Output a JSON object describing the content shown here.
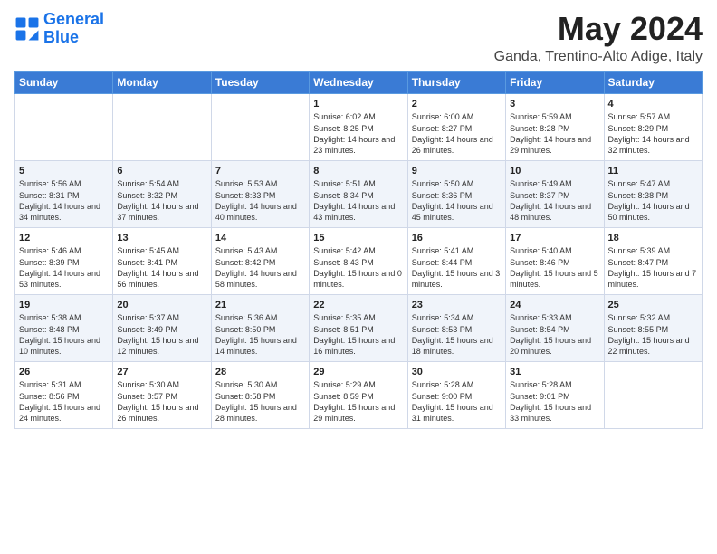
{
  "logo": {
    "line1": "General",
    "line2": "Blue"
  },
  "title": "May 2024",
  "subtitle": "Ganda, Trentino-Alto Adige, Italy",
  "days_of_week": [
    "Sunday",
    "Monday",
    "Tuesday",
    "Wednesday",
    "Thursday",
    "Friday",
    "Saturday"
  ],
  "weeks": [
    [
      {
        "day": "",
        "sunrise": "",
        "sunset": "",
        "daylight": ""
      },
      {
        "day": "",
        "sunrise": "",
        "sunset": "",
        "daylight": ""
      },
      {
        "day": "",
        "sunrise": "",
        "sunset": "",
        "daylight": ""
      },
      {
        "day": "1",
        "sunrise": "Sunrise: 6:02 AM",
        "sunset": "Sunset: 8:25 PM",
        "daylight": "Daylight: 14 hours and 23 minutes."
      },
      {
        "day": "2",
        "sunrise": "Sunrise: 6:00 AM",
        "sunset": "Sunset: 8:27 PM",
        "daylight": "Daylight: 14 hours and 26 minutes."
      },
      {
        "day": "3",
        "sunrise": "Sunrise: 5:59 AM",
        "sunset": "Sunset: 8:28 PM",
        "daylight": "Daylight: 14 hours and 29 minutes."
      },
      {
        "day": "4",
        "sunrise": "Sunrise: 5:57 AM",
        "sunset": "Sunset: 8:29 PM",
        "daylight": "Daylight: 14 hours and 32 minutes."
      }
    ],
    [
      {
        "day": "5",
        "sunrise": "Sunrise: 5:56 AM",
        "sunset": "Sunset: 8:31 PM",
        "daylight": "Daylight: 14 hours and 34 minutes."
      },
      {
        "day": "6",
        "sunrise": "Sunrise: 5:54 AM",
        "sunset": "Sunset: 8:32 PM",
        "daylight": "Daylight: 14 hours and 37 minutes."
      },
      {
        "day": "7",
        "sunrise": "Sunrise: 5:53 AM",
        "sunset": "Sunset: 8:33 PM",
        "daylight": "Daylight: 14 hours and 40 minutes."
      },
      {
        "day": "8",
        "sunrise": "Sunrise: 5:51 AM",
        "sunset": "Sunset: 8:34 PM",
        "daylight": "Daylight: 14 hours and 43 minutes."
      },
      {
        "day": "9",
        "sunrise": "Sunrise: 5:50 AM",
        "sunset": "Sunset: 8:36 PM",
        "daylight": "Daylight: 14 hours and 45 minutes."
      },
      {
        "day": "10",
        "sunrise": "Sunrise: 5:49 AM",
        "sunset": "Sunset: 8:37 PM",
        "daylight": "Daylight: 14 hours and 48 minutes."
      },
      {
        "day": "11",
        "sunrise": "Sunrise: 5:47 AM",
        "sunset": "Sunset: 8:38 PM",
        "daylight": "Daylight: 14 hours and 50 minutes."
      }
    ],
    [
      {
        "day": "12",
        "sunrise": "Sunrise: 5:46 AM",
        "sunset": "Sunset: 8:39 PM",
        "daylight": "Daylight: 14 hours and 53 minutes."
      },
      {
        "day": "13",
        "sunrise": "Sunrise: 5:45 AM",
        "sunset": "Sunset: 8:41 PM",
        "daylight": "Daylight: 14 hours and 56 minutes."
      },
      {
        "day": "14",
        "sunrise": "Sunrise: 5:43 AM",
        "sunset": "Sunset: 8:42 PM",
        "daylight": "Daylight: 14 hours and 58 minutes."
      },
      {
        "day": "15",
        "sunrise": "Sunrise: 5:42 AM",
        "sunset": "Sunset: 8:43 PM",
        "daylight": "Daylight: 15 hours and 0 minutes."
      },
      {
        "day": "16",
        "sunrise": "Sunrise: 5:41 AM",
        "sunset": "Sunset: 8:44 PM",
        "daylight": "Daylight: 15 hours and 3 minutes."
      },
      {
        "day": "17",
        "sunrise": "Sunrise: 5:40 AM",
        "sunset": "Sunset: 8:46 PM",
        "daylight": "Daylight: 15 hours and 5 minutes."
      },
      {
        "day": "18",
        "sunrise": "Sunrise: 5:39 AM",
        "sunset": "Sunset: 8:47 PM",
        "daylight": "Daylight: 15 hours and 7 minutes."
      }
    ],
    [
      {
        "day": "19",
        "sunrise": "Sunrise: 5:38 AM",
        "sunset": "Sunset: 8:48 PM",
        "daylight": "Daylight: 15 hours and 10 minutes."
      },
      {
        "day": "20",
        "sunrise": "Sunrise: 5:37 AM",
        "sunset": "Sunset: 8:49 PM",
        "daylight": "Daylight: 15 hours and 12 minutes."
      },
      {
        "day": "21",
        "sunrise": "Sunrise: 5:36 AM",
        "sunset": "Sunset: 8:50 PM",
        "daylight": "Daylight: 15 hours and 14 minutes."
      },
      {
        "day": "22",
        "sunrise": "Sunrise: 5:35 AM",
        "sunset": "Sunset: 8:51 PM",
        "daylight": "Daylight: 15 hours and 16 minutes."
      },
      {
        "day": "23",
        "sunrise": "Sunrise: 5:34 AM",
        "sunset": "Sunset: 8:53 PM",
        "daylight": "Daylight: 15 hours and 18 minutes."
      },
      {
        "day": "24",
        "sunrise": "Sunrise: 5:33 AM",
        "sunset": "Sunset: 8:54 PM",
        "daylight": "Daylight: 15 hours and 20 minutes."
      },
      {
        "day": "25",
        "sunrise": "Sunrise: 5:32 AM",
        "sunset": "Sunset: 8:55 PM",
        "daylight": "Daylight: 15 hours and 22 minutes."
      }
    ],
    [
      {
        "day": "26",
        "sunrise": "Sunrise: 5:31 AM",
        "sunset": "Sunset: 8:56 PM",
        "daylight": "Daylight: 15 hours and 24 minutes."
      },
      {
        "day": "27",
        "sunrise": "Sunrise: 5:30 AM",
        "sunset": "Sunset: 8:57 PM",
        "daylight": "Daylight: 15 hours and 26 minutes."
      },
      {
        "day": "28",
        "sunrise": "Sunrise: 5:30 AM",
        "sunset": "Sunset: 8:58 PM",
        "daylight": "Daylight: 15 hours and 28 minutes."
      },
      {
        "day": "29",
        "sunrise": "Sunrise: 5:29 AM",
        "sunset": "Sunset: 8:59 PM",
        "daylight": "Daylight: 15 hours and 29 minutes."
      },
      {
        "day": "30",
        "sunrise": "Sunrise: 5:28 AM",
        "sunset": "Sunset: 9:00 PM",
        "daylight": "Daylight: 15 hours and 31 minutes."
      },
      {
        "day": "31",
        "sunrise": "Sunrise: 5:28 AM",
        "sunset": "Sunset: 9:01 PM",
        "daylight": "Daylight: 15 hours and 33 minutes."
      },
      {
        "day": "",
        "sunrise": "",
        "sunset": "",
        "daylight": ""
      }
    ]
  ]
}
